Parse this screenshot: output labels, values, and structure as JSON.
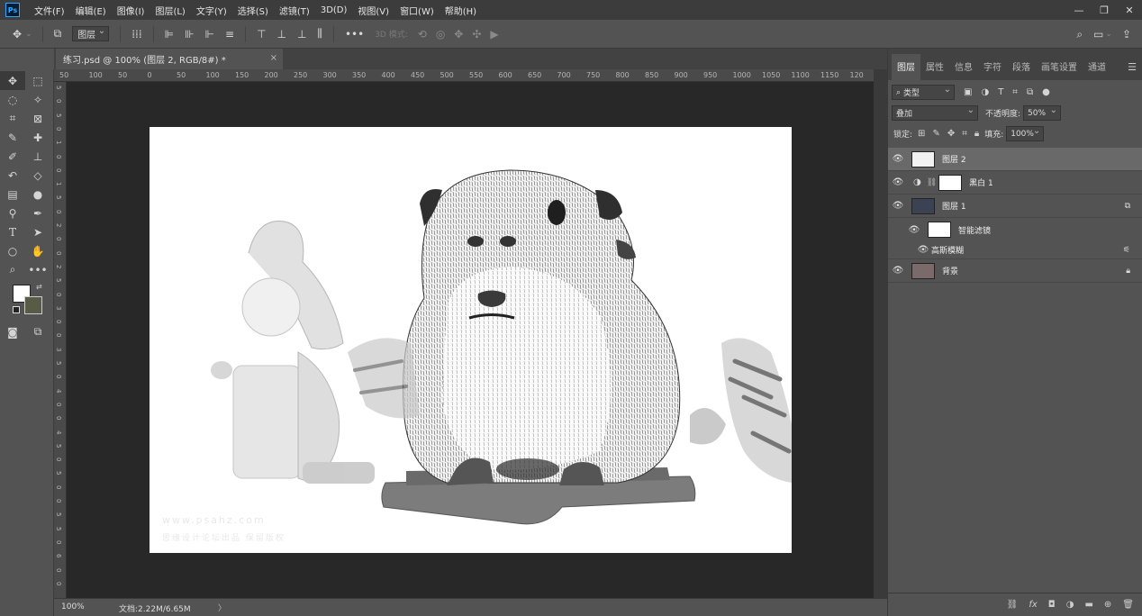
{
  "menubar": {
    "logo": "Ps",
    "items": [
      "文件(F)",
      "编辑(E)",
      "图像(I)",
      "图层(L)",
      "文字(Y)",
      "选择(S)",
      "滤镜(T)",
      "3D(D)",
      "视图(V)",
      "窗口(W)",
      "帮助(H)"
    ]
  },
  "options": {
    "auto_select_target": "图层",
    "mode_3d_label": "3D 模式:"
  },
  "document": {
    "tab_title": "练习.psd @ 100% (图层 2, RGB/8#) *",
    "tab_close": "×"
  },
  "rulers": {
    "top": [
      "50",
      "100",
      "50",
      "0",
      "50",
      "100",
      "150",
      "200",
      "250",
      "300",
      "350",
      "400",
      "450",
      "500",
      "550",
      "600",
      "650",
      "700",
      "750",
      "800",
      "850",
      "900",
      "950",
      "1000",
      "1050",
      "1100",
      "1150",
      "120"
    ],
    "left": [
      "5",
      "0",
      "5",
      "0",
      "1",
      "0",
      "0",
      "1",
      "5",
      "0",
      "2",
      "0",
      "0",
      "2",
      "5",
      "0",
      "3",
      "0",
      "0",
      "3",
      "5",
      "0",
      "4",
      "0",
      "0",
      "4",
      "5",
      "0",
      "5",
      "0",
      "0",
      "5",
      "5",
      "0",
      "6",
      "0",
      "0"
    ]
  },
  "canvas": {
    "watermark_line1": "www.psahz.com",
    "watermark_line2": "思缘设计论坛出品 保留版权"
  },
  "status": {
    "zoom": "100%",
    "doc_info": "文档:2.22M/6.65M",
    "arrow": "〉"
  },
  "panel": {
    "tabs": [
      "图层",
      "属性",
      "信息",
      "字符",
      "段落",
      "画笔设置",
      "通道"
    ],
    "filter_kind": "类型",
    "blend_mode": "叠加",
    "opacity_label": "不透明度:",
    "opacity_value": "50%",
    "lock_label": "锁定:",
    "fill_label": "填充:",
    "fill_value": "100%",
    "layers": [
      {
        "name": "图层 2"
      },
      {
        "name": "黑白 1"
      },
      {
        "name": "图层 1"
      },
      {
        "name": "智能滤镜"
      },
      {
        "name": "高斯模糊"
      },
      {
        "name": "背景"
      }
    ]
  },
  "colors": {
    "foreground": "#ffffff",
    "background": "#585c47",
    "accent": "#31a8ff"
  }
}
